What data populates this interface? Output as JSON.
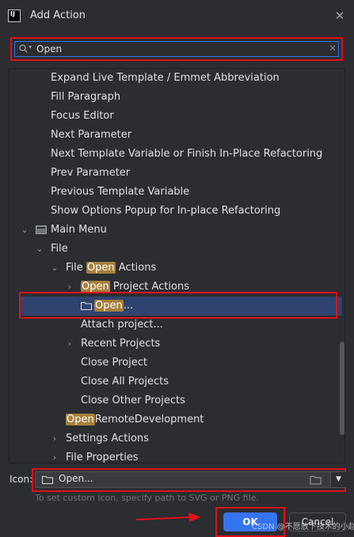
{
  "window": {
    "app_icon_text": "IJ",
    "title": "Add Action",
    "close_icon": "close-icon"
  },
  "search": {
    "value": "Open"
  },
  "tree": {
    "rows": [
      {
        "text": "Expand Live Template / Emmet Abbreviation"
      },
      {
        "text": "Fill Paragraph"
      },
      {
        "text": "Focus Editor"
      },
      {
        "text": "Next Parameter"
      },
      {
        "text": "Next Template Variable or Finish In-Place Refactoring"
      },
      {
        "text": "Prev Parameter"
      },
      {
        "text": "Previous Template Variable"
      },
      {
        "text": "Show Options Popup for In-place Refactoring"
      },
      {
        "text": "Main Menu"
      },
      {
        "text": "File"
      },
      {
        "pre": "File ",
        "hl": "Open",
        "post": " Actions"
      },
      {
        "pre": "",
        "hl": "Open",
        "post": " Project Actions"
      },
      {
        "pre": "",
        "hl": "Open",
        "post": "..."
      },
      {
        "text": "Attach project..."
      },
      {
        "text": "Recent Projects"
      },
      {
        "text": "Close Project"
      },
      {
        "text": "Close All Projects"
      },
      {
        "text": "Close Other Projects"
      },
      {
        "pre": "",
        "hl": "Open",
        "post": "RemoteDevelopment"
      },
      {
        "text": "Settings Actions"
      },
      {
        "text": "File Properties"
      }
    ]
  },
  "icon_field": {
    "label": "Icon:",
    "value": "Open...",
    "hint": "To set custom icon, specify path to SVG or PNG file."
  },
  "buttons": {
    "ok": "OK",
    "cancel": "Cancel"
  },
  "watermark": "CSDN @不愿放下技术的小赵",
  "colors": {
    "accent": "#3574f0",
    "highlight": "#a6803c",
    "selection": "#2e436e",
    "annotation": "#e0101b"
  }
}
